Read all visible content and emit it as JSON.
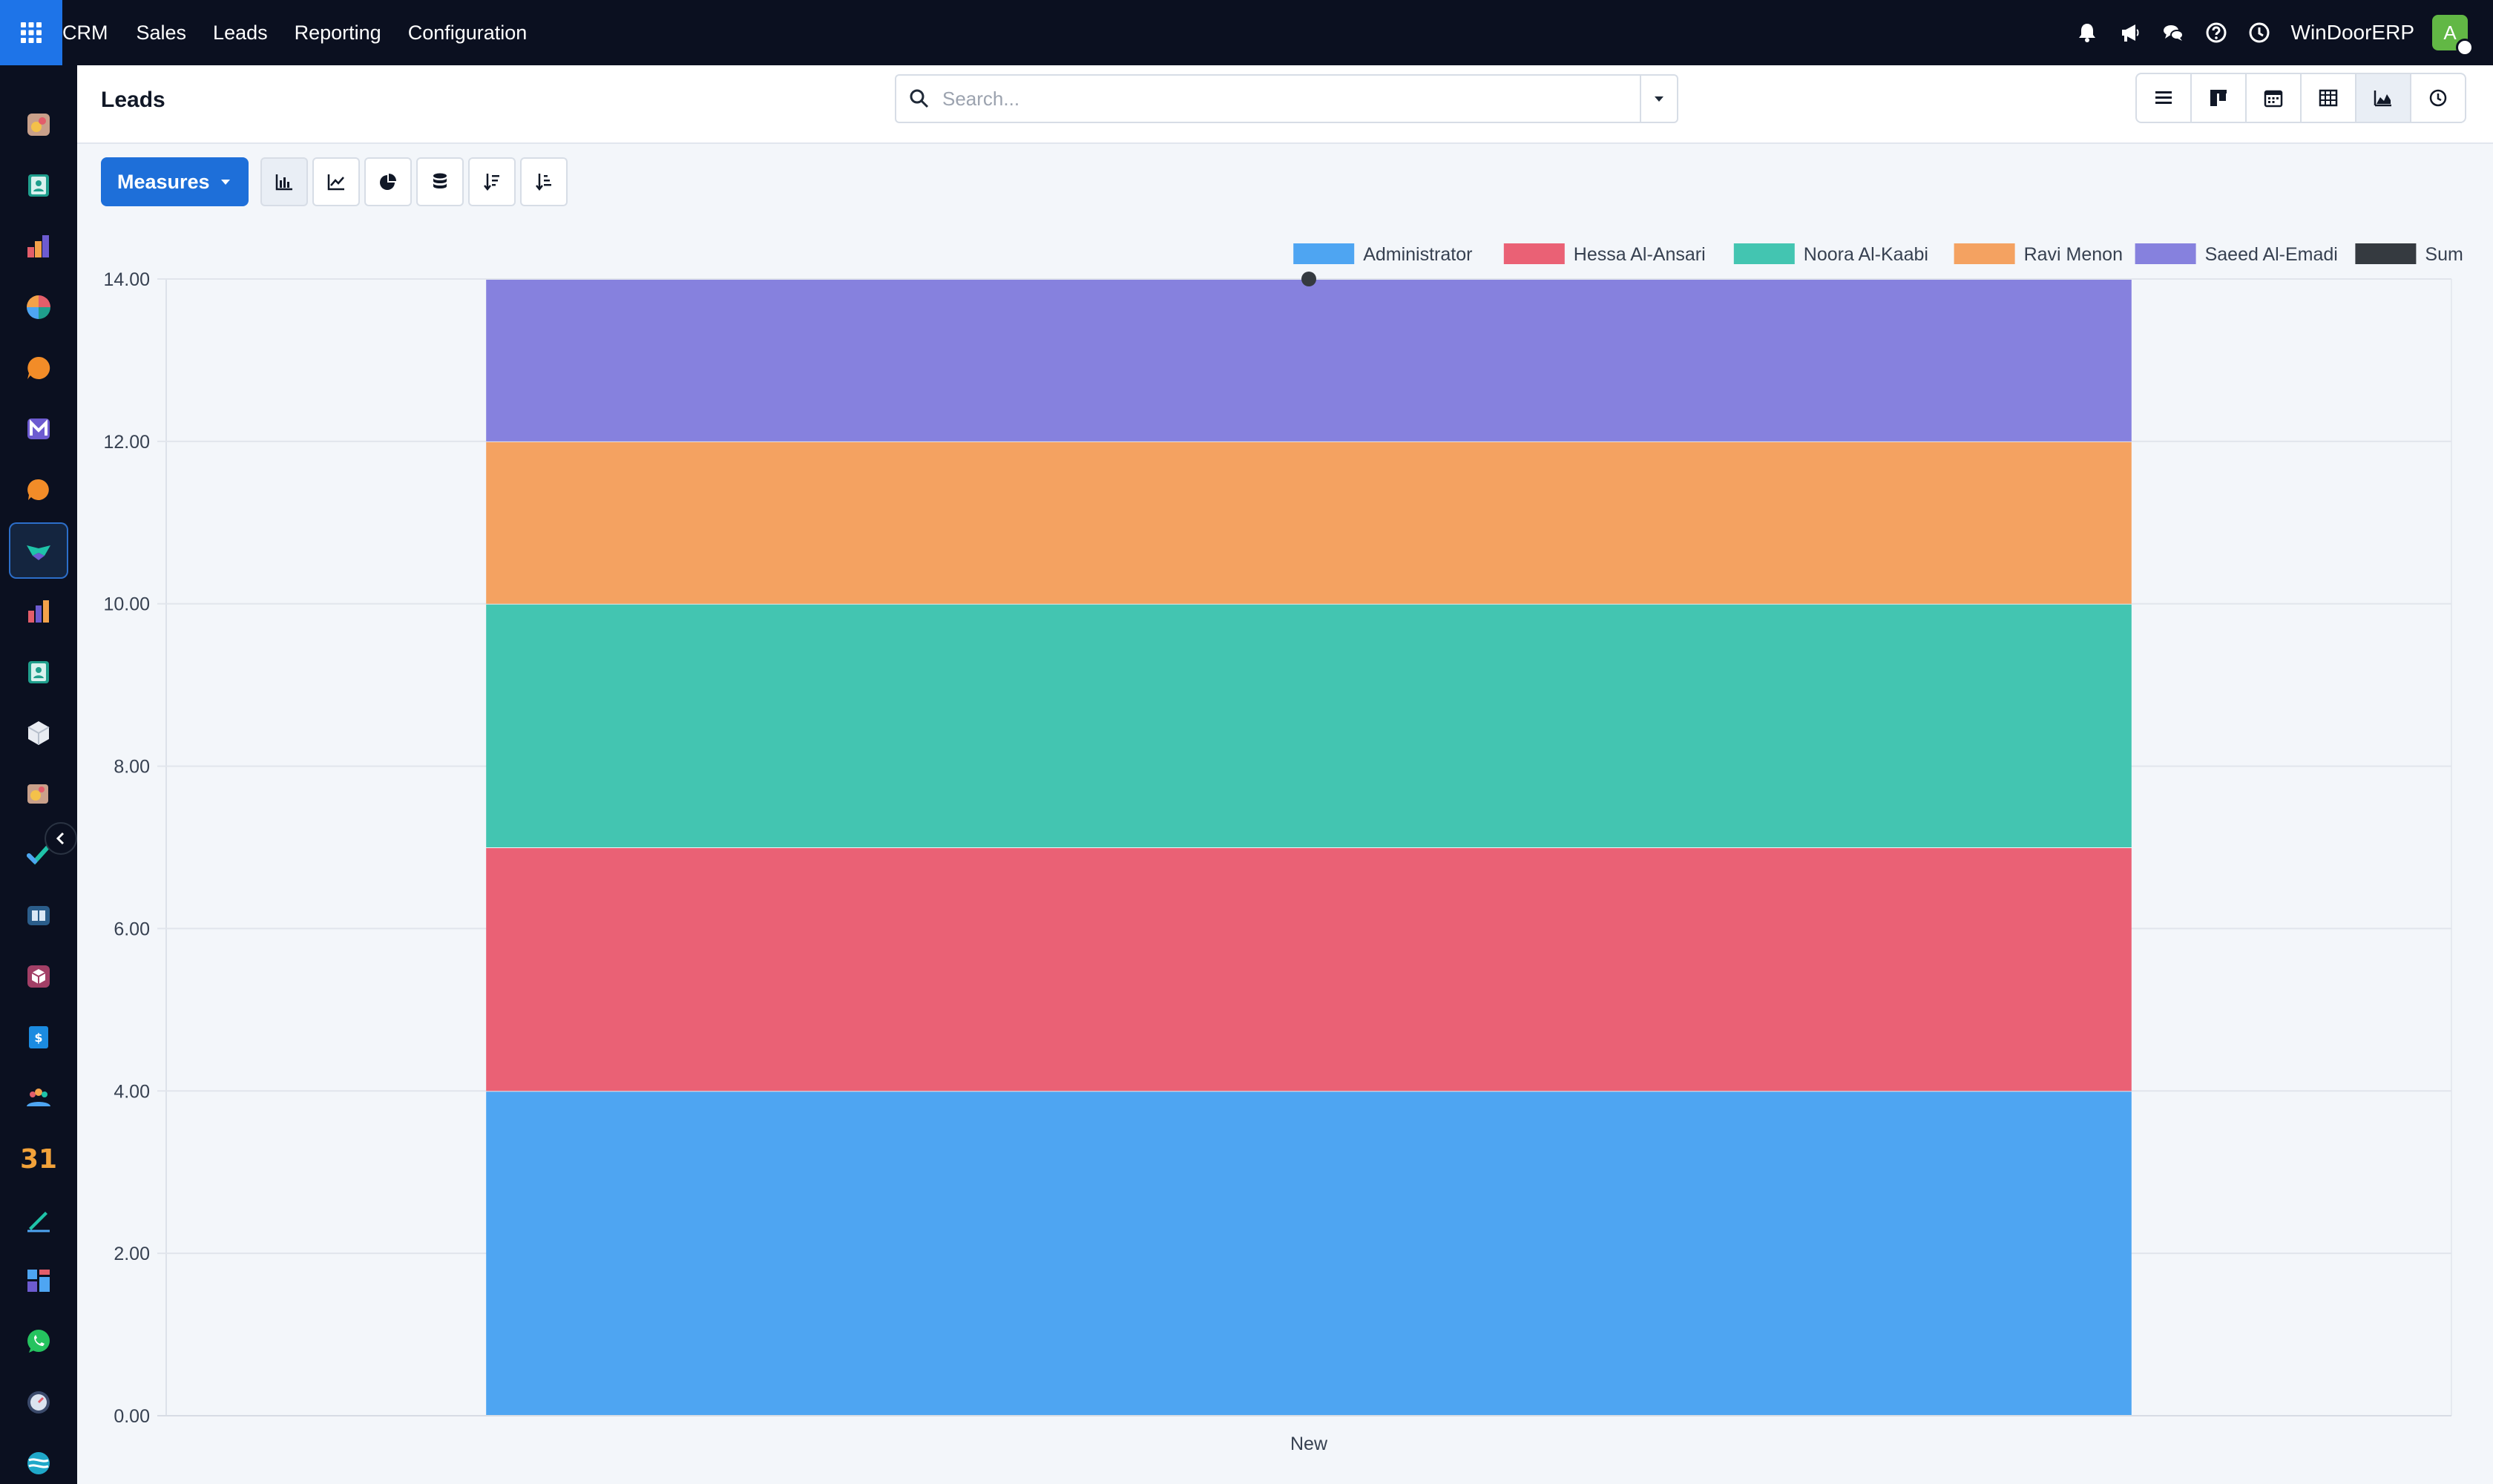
{
  "topbar": {
    "menu": [
      "CRM",
      "Sales",
      "Leads",
      "Reporting",
      "Configuration"
    ],
    "company": "WinDoorERP",
    "avatar_initial": "A",
    "icons": [
      "bell-icon",
      "megaphone-icon",
      "chat-icon",
      "help-icon",
      "clock-icon"
    ]
  },
  "sidebar": {
    "apps": [
      "dashboard-app-icon",
      "contacts-app-icon",
      "reporting-app-icon",
      "pie-app-icon",
      "discuss-app-icon",
      "mail-app-icon",
      "livechat-app-icon",
      "crm-app-icon",
      "sales-app-icon",
      "employees-app-icon",
      "inventory-app-icon",
      "art-app-icon",
      "todo-app-icon",
      "knowledge-app-icon",
      "product-app-icon",
      "invoicing-app-icon",
      "team-app-icon",
      "calendar-app-icon",
      "sign-app-icon",
      "dashboards-app-icon",
      "whatsapp-app-icon",
      "clock-app-icon",
      "website-app-icon"
    ],
    "calendar_label": "31",
    "active_index": 7
  },
  "control": {
    "title": "Leads",
    "search_placeholder": "Search...",
    "views": [
      "list-view",
      "kanban-view",
      "calendar-view",
      "pivot-view",
      "graph-view",
      "activity-view"
    ],
    "active_view": "graph-view"
  },
  "toolbar": {
    "measures_label": "Measures",
    "tools": [
      "bar-chart",
      "line-chart",
      "pie-chart",
      "stacked",
      "sort-descending",
      "sort-ascending"
    ]
  },
  "colors": {
    "primary": "#1e6fd9",
    "navbar": "#0b1020"
  },
  "chart_data": {
    "type": "bar",
    "stacked": true,
    "categories": [
      "New"
    ],
    "series": [
      {
        "name": "Administrator",
        "values": [
          4
        ],
        "color": "#4ea5f2"
      },
      {
        "name": "Hessa Al-Ansari",
        "values": [
          3
        ],
        "color": "#ea6175"
      },
      {
        "name": "Noora Al-Kaabi",
        "values": [
          3
        ],
        "color": "#43c5b1"
      },
      {
        "name": "Ravi Menon",
        "values": [
          2
        ],
        "color": "#f4a261"
      },
      {
        "name": "Saeed Al-Emadi",
        "values": [
          2
        ],
        "color": "#8681de"
      },
      {
        "name": "Sum",
        "values": [
          14
        ],
        "color": "#353a40",
        "type": "point"
      }
    ],
    "ylim": [
      0,
      14
    ],
    "yticks": [
      "0.00",
      "2.00",
      "4.00",
      "6.00",
      "8.00",
      "10.00",
      "12.00",
      "14.00"
    ],
    "grid": true,
    "legend": "top-right",
    "xlabel": "",
    "ylabel": ""
  }
}
